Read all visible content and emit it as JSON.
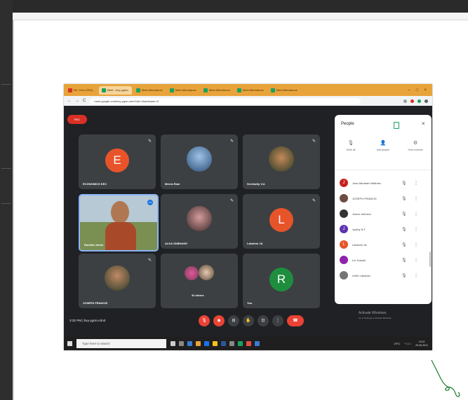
{
  "browser": {
    "tabs": [
      {
        "label": "Re: Chit (1392) -",
        "active": false
      },
      {
        "label": "Meet - bvy-ygmo-",
        "active": true
      },
      {
        "label": "Meet Attendance",
        "active": false
      },
      {
        "label": "Meet Attendance",
        "active": false
      },
      {
        "label": "Meet Attendance",
        "active": false
      },
      {
        "label": "Meet Attendance",
        "active": false
      },
      {
        "label": "Meet Attendance",
        "active": false
      }
    ],
    "url": "meet.google.com/bvy-ygmo-dmd?pli=1&authuser=0"
  },
  "meeting": {
    "rec_label": "REC",
    "time": "3:32 PM",
    "code": "bvy-ygmo-dmd",
    "tiles": [
      {
        "name": "ECONOMICS KEC",
        "initial": "E",
        "color": "#e8542a"
      },
      {
        "name": "Meera Ram",
        "initial": "",
        "color": ""
      },
      {
        "name": "Sreekutty V.A",
        "initial": "",
        "color": ""
      },
      {
        "name": "Ravitha Johns",
        "initial": "",
        "color": ""
      },
      {
        "name": "ALKA SUBHASH",
        "initial": "",
        "color": ""
      },
      {
        "name": "Lakshmi JA",
        "initial": "L",
        "color": "#e8542a"
      },
      {
        "name": "JOSEPH FRANCIS",
        "initial": "",
        "color": ""
      },
      {
        "name": "34 others",
        "initial": "",
        "color": ""
      },
      {
        "name": "You",
        "initial": "R",
        "color": "#1e8e3e"
      }
    ]
  },
  "people_panel": {
    "title": "People",
    "close": "×",
    "actions": [
      {
        "label": "Mute all",
        "icon": "mic-off-icon",
        "glyph": "🎙"
      },
      {
        "label": "Add people",
        "icon": "add-person-icon",
        "glyph": "👤"
      },
      {
        "label": "Host controls",
        "icon": "host-controls-icon",
        "glyph": "⚙"
      }
    ],
    "participants": [
      {
        "name": "Jose Abraham Mathew",
        "initial": "J",
        "color": "#c5221f"
      },
      {
        "name": "JOSEPH FRANCIS",
        "initial": "",
        "color": "#6d4c41"
      },
      {
        "name": "Josna Johnson",
        "initial": "",
        "color": "#333333"
      },
      {
        "name": "Jyothy N.T",
        "initial": "J",
        "color": "#5e35b1"
      },
      {
        "name": "Lakshmi JA",
        "initial": "L",
        "color": "#e8542a"
      },
      {
        "name": "Liz Joseph",
        "initial": "",
        "color": "#8e24aa"
      },
      {
        "name": "Linith Lakshan",
        "initial": "",
        "color": "#757575"
      }
    ]
  },
  "windows_notice": {
    "title": "Activate Windows",
    "subtitle": "Go to Settings to activate Windows."
  },
  "taskbar": {
    "search_placeholder": "Type here to search",
    "temperature": "29°C",
    "time": "15:32",
    "date": "25-06-2021"
  }
}
